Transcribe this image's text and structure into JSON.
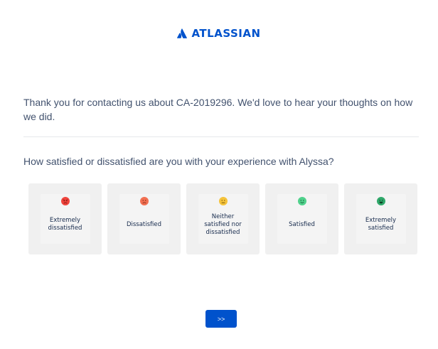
{
  "brand": {
    "name": "ATLASSIAN",
    "color": "#0052cc"
  },
  "intro_text": "Thank you for contacting us about CA-2019296. We'd love to hear your thoughts on how we did.",
  "question": "How satisfied or dissatisfied are you with your experience with Alyssa?",
  "options": [
    {
      "label": "Extremely dissatisfied",
      "icon": "very-angry-face-icon",
      "color": "#f0443c"
    },
    {
      "label": "Dissatisfied",
      "icon": "frowning-face-icon",
      "color": "#f26f51"
    },
    {
      "label": "Neither satisfied nor dissatisfied",
      "icon": "neutral-face-icon",
      "color": "#f5c33b"
    },
    {
      "label": "Satisfied",
      "icon": "smiling-face-icon",
      "color": "#4fd18b"
    },
    {
      "label": "Extremely satisfied",
      "icon": "grinning-face-icon",
      "color": "#2fa86a"
    }
  ],
  "next_button": {
    "label": ">>"
  }
}
